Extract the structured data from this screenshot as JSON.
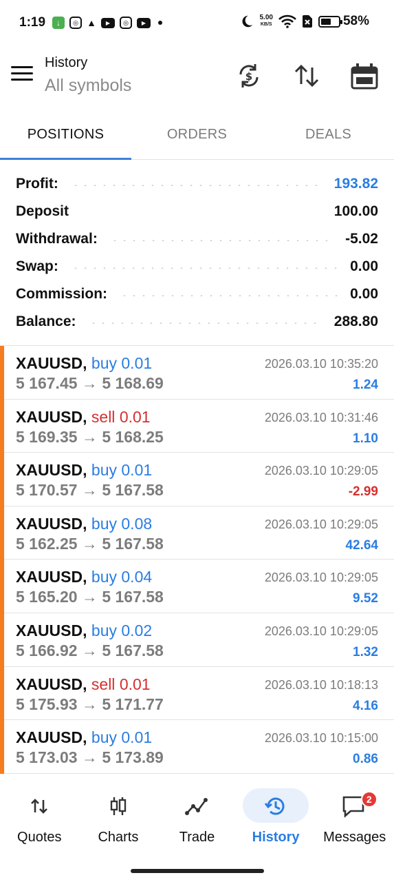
{
  "status_bar": {
    "time": "1:19",
    "speed_value": "5.00",
    "speed_unit": "KB/S",
    "battery": "58%",
    "battery_level": 0.58
  },
  "header": {
    "title": "History",
    "subtitle": "All symbols",
    "icons": [
      "menu-icon",
      "currency-exchange-icon",
      "sort-icon",
      "calendar-icon"
    ]
  },
  "tabs": [
    {
      "label": "POSITIONS",
      "active": true
    },
    {
      "label": "ORDERS",
      "active": false
    },
    {
      "label": "DEALS",
      "active": false
    }
  ],
  "summary": [
    {
      "label": "Profit:",
      "value": "193.82",
      "highlight": true
    },
    {
      "label": "Deposit",
      "value": "100.00",
      "highlight": false
    },
    {
      "label": "Withdrawal:",
      "value": "-5.02",
      "highlight": false
    },
    {
      "label": "Swap:",
      "value": "0.00",
      "highlight": false
    },
    {
      "label": "Commission:",
      "value": "0.00",
      "highlight": false
    },
    {
      "label": "Balance:",
      "value": "288.80",
      "highlight": false
    }
  ],
  "deals": [
    {
      "symbol": "XAUUSD,",
      "type": "buy",
      "volume": "0.01",
      "open": "5 167.45",
      "close": "5 168.69",
      "time": "2026.03.10 10:35:20",
      "profit": "1.24"
    },
    {
      "symbol": "XAUUSD,",
      "type": "sell",
      "volume": "0.01",
      "open": "5 169.35",
      "close": "5 168.25",
      "time": "2026.03.10 10:31:46",
      "profit": "1.10"
    },
    {
      "symbol": "XAUUSD,",
      "type": "buy",
      "volume": "0.01",
      "open": "5 170.57",
      "close": "5 167.58",
      "time": "2026.03.10 10:29:05",
      "profit": "-2.99"
    },
    {
      "symbol": "XAUUSD,",
      "type": "buy",
      "volume": "0.08",
      "open": "5 162.25",
      "close": "5 167.58",
      "time": "2026.03.10 10:29:05",
      "profit": "42.64"
    },
    {
      "symbol": "XAUUSD,",
      "type": "buy",
      "volume": "0.04",
      "open": "5 165.20",
      "close": "5 167.58",
      "time": "2026.03.10 10:29:05",
      "profit": "9.52"
    },
    {
      "symbol": "XAUUSD,",
      "type": "buy",
      "volume": "0.02",
      "open": "5 166.92",
      "close": "5 167.58",
      "time": "2026.03.10 10:29:05",
      "profit": "1.32"
    },
    {
      "symbol": "XAUUSD,",
      "type": "sell",
      "volume": "0.01",
      "open": "5 175.93",
      "close": "5 171.77",
      "time": "2026.03.10 10:18:13",
      "profit": "4.16"
    },
    {
      "symbol": "XAUUSD,",
      "type": "buy",
      "volume": "0.01",
      "open": "5 173.03",
      "close": "5 173.89",
      "time": "2026.03.10 10:15:00",
      "profit": "0.86"
    }
  ],
  "arrow": "→",
  "bottom_nav": [
    {
      "label": "Quotes",
      "icon": "quotes-arrows-icon",
      "active": false
    },
    {
      "label": "Charts",
      "icon": "candlestick-icon",
      "active": false
    },
    {
      "label": "Trade",
      "icon": "trade-line-icon",
      "active": false
    },
    {
      "label": "History",
      "icon": "history-clock-icon",
      "active": true
    },
    {
      "label": "Messages",
      "icon": "messages-icon",
      "active": false,
      "badge": "2"
    }
  ],
  "colors": {
    "accent_blue": "#2a7de1",
    "sell_red": "#d62f2f",
    "position_marker": "#f57c1f",
    "tab_underline": "#3d7fd9"
  }
}
